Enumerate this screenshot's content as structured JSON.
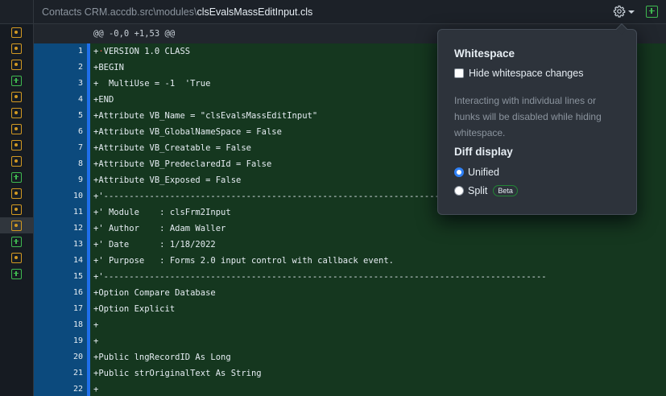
{
  "header": {
    "path_prefix": "Contacts CRM.accdb.src\\modules\\",
    "file_name": "clsEvalsMassEditInput.cls"
  },
  "gutter_status": [
    "modified",
    "modified",
    "modified",
    "added",
    "modified",
    "modified",
    "modified",
    "modified",
    "modified",
    "added",
    "modified",
    "modified",
    "modified",
    "added",
    "modified",
    "added"
  ],
  "hunk": "@@ -0,0 +1,53 @@",
  "lines": [
    {
      "num": "1",
      "marker": "+",
      "bom": "·",
      "text": "VERSION 1.0 CLASS"
    },
    {
      "num": "2",
      "marker": "+",
      "bom": "",
      "text": "BEGIN"
    },
    {
      "num": "3",
      "marker": "+",
      "bom": "",
      "text": "  MultiUse = -1  'True"
    },
    {
      "num": "4",
      "marker": "+",
      "bom": "",
      "text": "END"
    },
    {
      "num": "5",
      "marker": "+",
      "bom": "",
      "text": "Attribute VB_Name = \"clsEvalsMassEditInput\""
    },
    {
      "num": "6",
      "marker": "+",
      "bom": "",
      "text": "Attribute VB_GlobalNameSpace = False"
    },
    {
      "num": "7",
      "marker": "+",
      "bom": "",
      "text": "Attribute VB_Creatable = False"
    },
    {
      "num": "8",
      "marker": "+",
      "bom": "",
      "text": "Attribute VB_PredeclaredId = False"
    },
    {
      "num": "9",
      "marker": "+",
      "bom": "",
      "text": "Attribute VB_Exposed = False"
    },
    {
      "num": "10",
      "marker": "+",
      "bom": "",
      "text": "'---------------------------------------------------------------------------------------"
    },
    {
      "num": "11",
      "marker": "+",
      "bom": "",
      "text": "' Module    : clsFrm2Input"
    },
    {
      "num": "12",
      "marker": "+",
      "bom": "",
      "text": "' Author    : Adam Waller"
    },
    {
      "num": "13",
      "marker": "+",
      "bom": "",
      "text": "' Date      : 1/18/2022"
    },
    {
      "num": "14",
      "marker": "+",
      "bom": "",
      "text": "' Purpose   : Forms 2.0 input control with callback event."
    },
    {
      "num": "15",
      "marker": "+",
      "bom": "",
      "text": "'---------------------------------------------------------------------------------------"
    },
    {
      "num": "16",
      "marker": "+",
      "bom": "",
      "text": "Option Compare Database"
    },
    {
      "num": "17",
      "marker": "+",
      "bom": "",
      "text": "Option Explicit"
    },
    {
      "num": "18",
      "marker": "+",
      "bom": "",
      "text": ""
    },
    {
      "num": "19",
      "marker": "+",
      "bom": "",
      "text": ""
    },
    {
      "num": "20",
      "marker": "+",
      "bom": "",
      "text": "Public lngRecordID As Long"
    },
    {
      "num": "21",
      "marker": "+",
      "bom": "",
      "text": "Public strOriginalText As String"
    },
    {
      "num": "22",
      "marker": "+",
      "bom": "",
      "text": ""
    }
  ],
  "popover": {
    "whitespace_title": "Whitespace",
    "hide_whitespace_label": "Hide whitespace changes",
    "hide_whitespace_checked": false,
    "note": "Interacting with individual lines or hunks will be disabled while hiding whitespace.",
    "diff_display_title": "Diff display",
    "unified_label": "Unified",
    "split_label": "Split",
    "beta_label": "Beta",
    "selected_mode": "Unified"
  },
  "colors": {
    "added_line_bg": "#15371f",
    "selected_gutter": "#0c4a7d",
    "change_bar": "#1f6feb",
    "modified_status": "#d29922",
    "added_status": "#3fb950",
    "radio_accent": "#2f81f7"
  }
}
